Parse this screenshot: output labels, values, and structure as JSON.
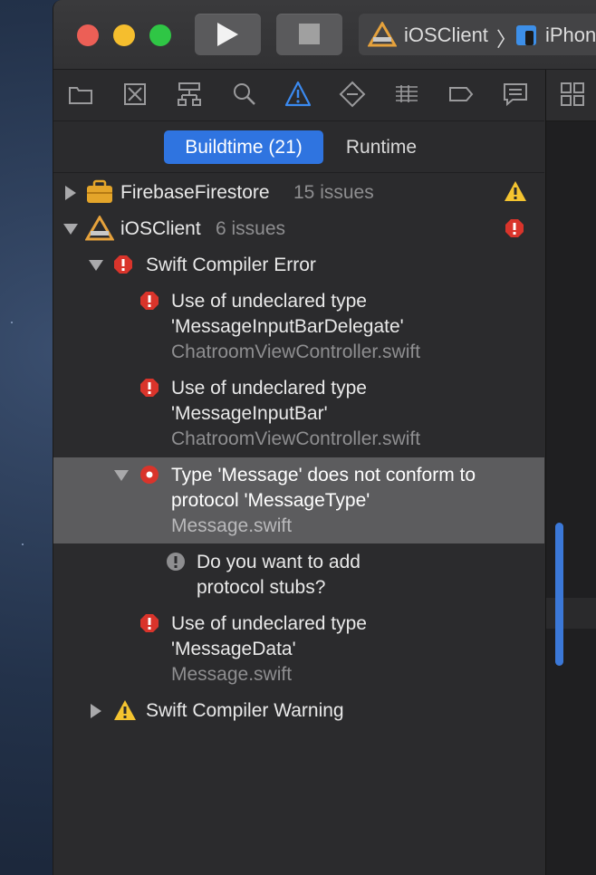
{
  "toolbar": {
    "scheme_project": "iOSClient",
    "scheme_chevron": "〉",
    "scheme_device": "iPhon"
  },
  "navigator": {
    "icons": [
      "project-navigator-icon",
      "source-control-icon",
      "symbol-navigator-icon",
      "find-icon",
      "issue-navigator-icon",
      "test-navigator-icon",
      "debug-navigator-icon",
      "breakpoint-navigator-icon",
      "report-navigator-icon"
    ],
    "active_icon": "issue-navigator-icon"
  },
  "tabs": {
    "buildtime": "Buildtime (21)",
    "runtime": "Runtime"
  },
  "issues": {
    "firebase": {
      "name": "FirebaseFirestore",
      "count": "15 issues"
    },
    "ios": {
      "name": "iOSClient",
      "count": "6 issues"
    },
    "swift_error_group": "Swift Compiler Error",
    "items": [
      {
        "line1": "Use of undeclared type",
        "line2": "'MessageInputBarDelegate'",
        "file": "ChatroomViewController.swift"
      },
      {
        "line1": "Use of undeclared type",
        "line2": "'MessageInputBar'",
        "file": "ChatroomViewController.swift"
      },
      {
        "line1": "Type 'Message' does not conform to",
        "line2": "protocol 'MessageType'",
        "file": "Message.swift"
      },
      {
        "line1": "Use of undeclared type",
        "line2": "'MessageData'",
        "file": "Message.swift"
      }
    ],
    "fixit": {
      "line1": "Do you want to add",
      "line2": "protocol stubs?"
    },
    "swift_warning_group": "Swift Compiler Warning"
  },
  "colors": {
    "error": "#d9342b",
    "warning": "#f4c430",
    "accent": "#2f74e0",
    "selected_row": "#5c5c5e"
  }
}
